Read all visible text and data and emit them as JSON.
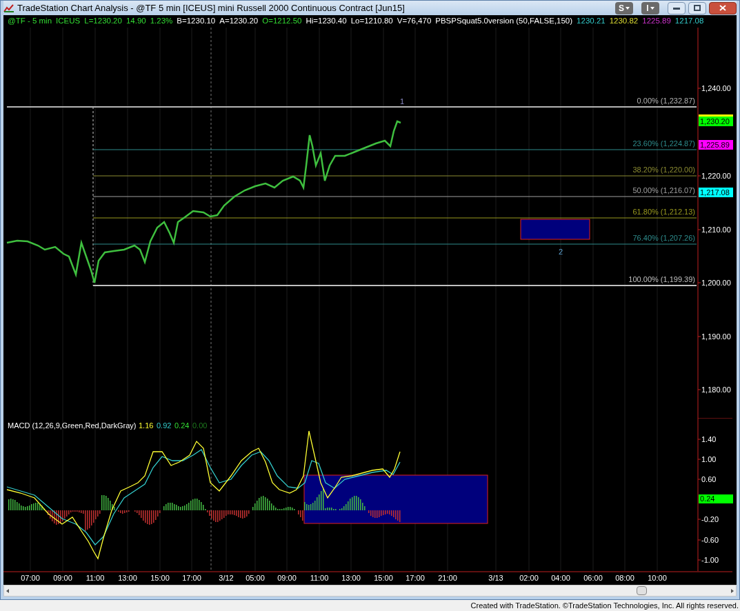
{
  "window": {
    "title": "TradeStation Chart Analysis - @TF 5 min [ICEUS] mini Russell 2000 Continuous Contract [Jun15]",
    "menu_buttons": [
      "S",
      "I"
    ]
  },
  "header": [
    {
      "text": "@TF - 5 min",
      "color": "#33dd33"
    },
    {
      "text": "ICEUS",
      "color": "#33dd33"
    },
    {
      "text": "L=1230.20",
      "color": "#33dd33"
    },
    {
      "text": "14.90",
      "color": "#33dd33"
    },
    {
      "text": "1.23%",
      "color": "#33dd33"
    },
    {
      "text": "B=1230.10",
      "color": "#ffffff"
    },
    {
      "text": "A=1230.20",
      "color": "#ffffff"
    },
    {
      "text": "O=1212.50",
      "color": "#33dd33"
    },
    {
      "text": "Hi=1230.40",
      "color": "#ffffff"
    },
    {
      "text": "Lo=1210.80",
      "color": "#ffffff"
    },
    {
      "text": "V=76,470",
      "color": "#ffffff"
    },
    {
      "text": "PBSPSquat5.0version (50,FALSE,150)",
      "color": "#ffffff"
    },
    {
      "text": "1230.21",
      "color": "#33cccc"
    },
    {
      "text": "1230.82",
      "color": "#dddd33"
    },
    {
      "text": "1225.89",
      "color": "#cc33cc"
    },
    {
      "text": "1217.08",
      "color": "#33cccc"
    }
  ],
  "price_axis": [
    "1,240.00",
    "1,220.00",
    "1,210.00",
    "1,200.00",
    "1,190.00",
    "1,180.00"
  ],
  "price_markers": [
    {
      "text": "1,230.20",
      "color": "#00ff00"
    },
    {
      "text": "1,225.89",
      "color": "#ff00ff"
    },
    {
      "text": "1,217.08",
      "color": "#00ffff"
    }
  ],
  "fib_levels": [
    {
      "label": "0.00% (1,232.87)",
      "color": "#b4b4b4"
    },
    {
      "label": "23.60% (1,224.87)",
      "color": "#2e8c8c"
    },
    {
      "label": "38.20% (1,220.00)",
      "color": "#8c8c32"
    },
    {
      "label": "50.00% (1,216.07)",
      "color": "#a0a0a0"
    },
    {
      "label": "61.80% (1,212.13)",
      "color": "#9a9a1e"
    },
    {
      "label": "76.40% (1,207.26)",
      "color": "#2e8c8c"
    },
    {
      "label": "100.00% (1,199.39)",
      "color": "#c0c0c0"
    }
  ],
  "wave_labels": [
    "1",
    "2"
  ],
  "macd": {
    "title": "MACD (12,26,9,Green,Red,DarkGray)",
    "values": [
      {
        "text": "1.16",
        "color": "#ffff33"
      },
      {
        "text": "0.92",
        "color": "#33cccc"
      },
      {
        "text": "0.24",
        "color": "#33dd33"
      },
      {
        "text": "0.00",
        "color": "#1e7a1e"
      }
    ],
    "axis": [
      "1.40",
      "1.00",
      "0.60",
      "-0.20",
      "-0.60",
      "-1.00"
    ],
    "marker": "0.24"
  },
  "time_axis": [
    "07:00",
    "09:00",
    "11:00",
    "13:00",
    "15:00",
    "17:00",
    "3/12",
    "05:00",
    "09:00",
    "11:00",
    "13:00",
    "15:00",
    "17:00",
    "21:00",
    "3/13",
    "02:00",
    "04:00",
    "06:00",
    "08:00",
    "10:00"
  ],
  "footer": "Created with TradeStation. ©TradeStation Technologies, Inc. All rights reserved."
}
